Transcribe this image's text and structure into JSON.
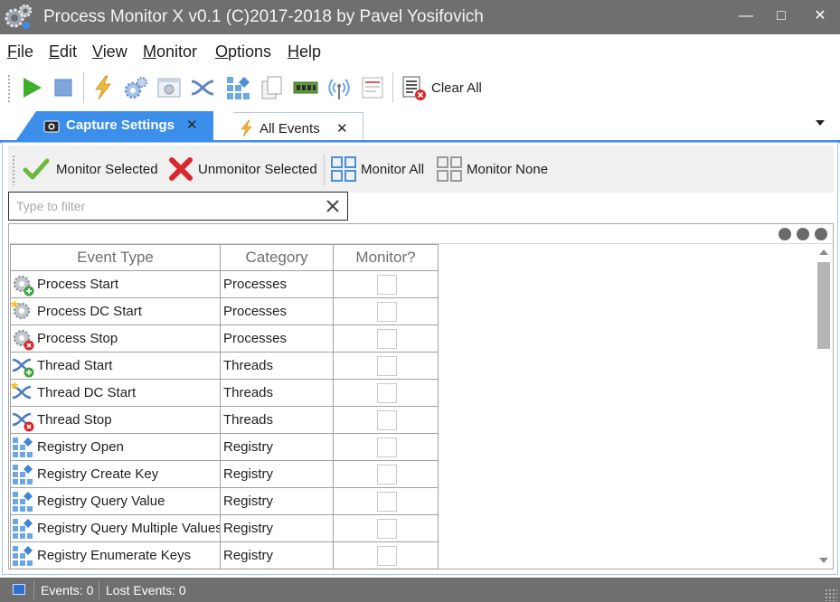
{
  "window": {
    "title": "Process Monitor X v0.1 (C)2017-2018 by Pavel Yosifovich",
    "minimize_glyph": "—",
    "maximize_glyph": "□",
    "close_glyph": "✕"
  },
  "menu": {
    "items": [
      {
        "accel": "F",
        "rest": "ile"
      },
      {
        "accel": "E",
        "rest": "dit"
      },
      {
        "accel": "V",
        "rest": "iew"
      },
      {
        "accel": "M",
        "rest": "onitor"
      },
      {
        "accel": "O",
        "rest": "ptions"
      },
      {
        "accel": "H",
        "rest": "elp"
      }
    ]
  },
  "toolbar": {
    "icons": [
      "play-icon",
      "stop-icon",
      "lightning-icon",
      "gears-icon",
      "process-window-icon",
      "thread-icon",
      "registry-icon",
      "copy-icon",
      "memory-chip-icon",
      "network-antenna-icon",
      "file-icon",
      "clear-list-icon"
    ],
    "clear_all_label": "Clear All"
  },
  "tabs": [
    {
      "label": "Capture Settings",
      "active": true,
      "close": "✕",
      "icon": "camera-icon"
    },
    {
      "label": "All Events",
      "active": false,
      "close": "✕",
      "icon": "lightning-icon"
    }
  ],
  "actions": {
    "monitor_selected": "Monitor Selected",
    "unmonitor_selected": "Unmonitor Selected",
    "monitor_all": "Monitor All",
    "monitor_none": "Monitor None"
  },
  "filter": {
    "placeholder": "Type to filter",
    "value": ""
  },
  "grid": {
    "columns": [
      "Event Type",
      "Category",
      "Monitor?"
    ],
    "rows": [
      {
        "event_type": "Process Start",
        "category": "Processes",
        "icon": "process-start-icon",
        "monitored": false
      },
      {
        "event_type": "Process DC Start",
        "category": "Processes",
        "icon": "process-dc-start-icon",
        "monitored": false
      },
      {
        "event_type": "Process Stop",
        "category": "Processes",
        "icon": "process-stop-icon",
        "monitored": false
      },
      {
        "event_type": "Thread Start",
        "category": "Threads",
        "icon": "thread-start-icon",
        "monitored": false
      },
      {
        "event_type": "Thread DC Start",
        "category": "Threads",
        "icon": "thread-dc-start-icon",
        "monitored": false
      },
      {
        "event_type": "Thread Stop",
        "category": "Threads",
        "icon": "thread-stop-icon",
        "monitored": false
      },
      {
        "event_type": "Registry Open",
        "category": "Registry",
        "icon": "registry-open-icon",
        "monitored": false
      },
      {
        "event_type": "Registry Create Key",
        "category": "Registry",
        "icon": "registry-create-key-icon",
        "monitored": false
      },
      {
        "event_type": "Registry Query Value",
        "category": "Registry",
        "icon": "registry-query-value-icon",
        "monitored": false
      },
      {
        "event_type": "Registry Query Multiple Values",
        "category": "Registry",
        "icon": "registry-query-multiple-values-icon",
        "monitored": false
      },
      {
        "event_type": "Registry Enumerate Keys",
        "category": "Registry",
        "icon": "registry-enumerate-keys-icon",
        "monitored": false
      }
    ]
  },
  "status": {
    "events": "Events: 0",
    "lost_events": "Lost Events: 0"
  },
  "colors": {
    "accent": "#3b8eea",
    "titlebar": "#6f6f6f",
    "statusbar": "#6f6f6f"
  }
}
